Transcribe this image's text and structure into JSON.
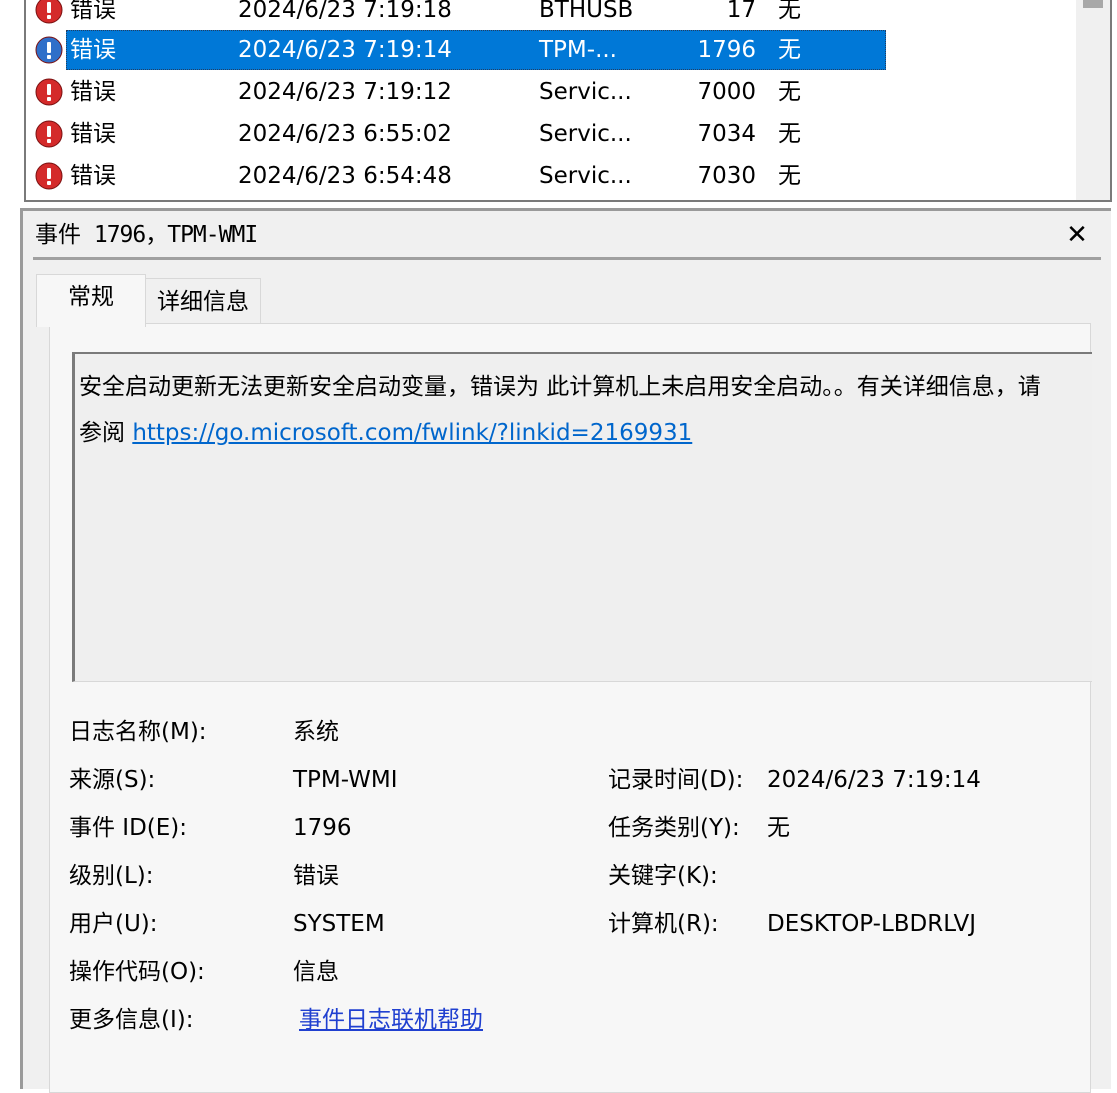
{
  "event_list": {
    "rows": [
      {
        "level": "错误",
        "date": "2024/6/23 7:19:18",
        "source": "BTHUSB",
        "event_id": "17",
        "task_category": "无",
        "icon": "error-icon",
        "selected": false
      },
      {
        "level": "错误",
        "date": "2024/6/23 7:19:14",
        "source": "TPM-...",
        "event_id": "1796",
        "task_category": "无",
        "icon": "error-icon",
        "selected": true
      },
      {
        "level": "错误",
        "date": "2024/6/23 7:19:12",
        "source": "Servic...",
        "event_id": "7000",
        "task_category": "无",
        "icon": "error-icon",
        "selected": false
      },
      {
        "level": "错误",
        "date": "2024/6/23 6:55:02",
        "source": "Servic...",
        "event_id": "7034",
        "task_category": "无",
        "icon": "error-icon",
        "selected": false
      },
      {
        "level": "错误",
        "date": "2024/6/23 6:54:48",
        "source": "Servic...",
        "event_id": "7030",
        "task_category": "无",
        "icon": "error-icon",
        "selected": false
      }
    ],
    "selection_color": "#0078d7",
    "error_color": "#d42a2a"
  },
  "detail": {
    "title_prefix": "事件",
    "title_rest": " 1796，TPM-WMI",
    "close_glyph": "✕",
    "tabs": [
      {
        "label": "常规",
        "active": true
      },
      {
        "label": "详细信息",
        "active": false
      }
    ],
    "description_line1": "安全启动更新无法更新安全启动变量，错误为 此计算机上未启用安全启动。。有关详细信息，请",
    "description_line2_prefix": "参阅 ",
    "description_link": "https://go.microsoft.com/fwlink/?linkid=2169931",
    "fields": {
      "log_name_label": "日志名称(M):",
      "log_name": "系统",
      "source_label": "来源(S):",
      "source": "TPM-WMI",
      "logged_label": "记录时间(D):",
      "logged": "2024/6/23 7:19:14",
      "event_id_label": "事件 ID(E):",
      "event_id": "1796",
      "task_category_label": "任务类别(Y):",
      "task_category": "无",
      "level_label": "级别(L):",
      "level": "错误",
      "keywords_label": "关键字(K):",
      "keywords": "",
      "user_label": "用户(U):",
      "user": "SYSTEM",
      "computer_label": "计算机(R):",
      "computer": "DESKTOP-LBDRLVJ",
      "opcode_label": "操作代码(O):",
      "opcode": "信息",
      "more_info_label": "更多信息(I):",
      "more_info_link": "事件日志联机帮助"
    }
  }
}
